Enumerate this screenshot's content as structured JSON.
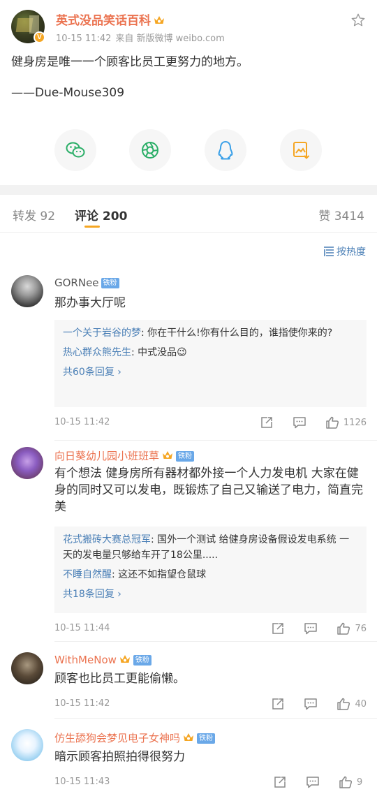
{
  "post": {
    "author": "英式没品笑话百科",
    "time": "10-15 11:42",
    "source": "来自 新版微博 weibo.com",
    "text": "健身房是唯一一个顾客比员工更努力的地方。\n\n——Due-Mouse309",
    "colors": {
      "name": "#eb7350",
      "accent": "#f5a623",
      "link": "#4a7fb6"
    },
    "share_icons": [
      "wechat-icon",
      "moments-icon",
      "qq-icon",
      "save-image-icon"
    ]
  },
  "tabs": {
    "repost": "转发 92",
    "comments": "评论 200",
    "likes": "赞 3414"
  },
  "sort_label": "按热度",
  "comments": [
    {
      "name": "GORNee",
      "badge": "铁粉",
      "text": "那办事大厅呢",
      "replies": [
        {
          "user": "一个关于岩谷的梦",
          "text": ": 你在干什么!你有什么目的，谁指使你来的?"
        },
        {
          "user": "热心群众熊先生",
          "text": ": 中式没品😉"
        }
      ],
      "more": "共60条回复 ›",
      "time": "10-15 11:42",
      "likes": "1126"
    },
    {
      "name": "向日葵幼儿园小班班草",
      "badge": "铁粉",
      "text": "有个想法  健身房所有器材都外接一个人力发电机 大家在健身的同时又可以发电，既锻炼了自己又输送了电力，简直完美",
      "replies": [
        {
          "user": "花式搬砖大赛总冠军",
          "text": ": 国外一个测试 给健身房设备假设发电系统 一天的发电量只够给车开了18公里....."
        },
        {
          "user": "不睡自然醒",
          "text": ": 这还不如指望仓鼠球"
        }
      ],
      "more": "共18条回复 ›",
      "time": "10-15 11:44",
      "likes": "76"
    },
    {
      "name": "WithMeNow",
      "badge": "铁粉",
      "text": "顾客也比员工更能偷懒。",
      "time": "10-15 11:42",
      "likes": "40"
    },
    {
      "name": "仿生舔狗会梦见电子女神吗",
      "badge": "铁粉",
      "text": "暗示顾客拍照拍得很努力",
      "time": "10-15 11:43",
      "likes": "9"
    }
  ]
}
